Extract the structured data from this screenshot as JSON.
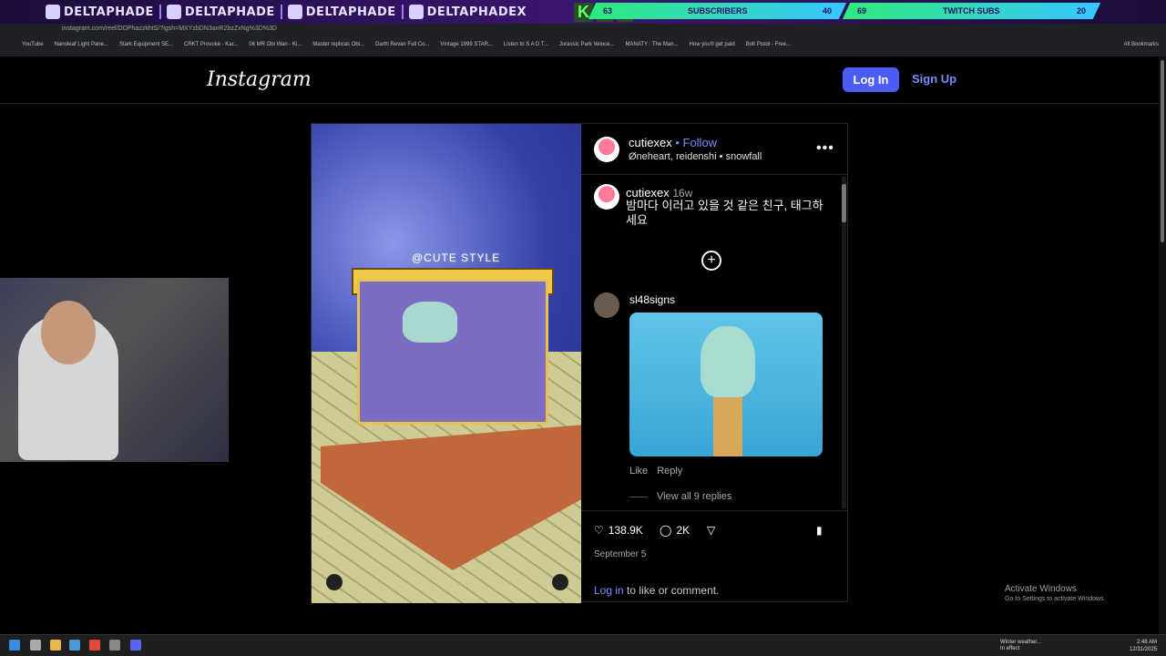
{
  "overlay": {
    "social_tags": [
      "DELTAPHADE",
      "DELTAPHADE",
      "DELTAPHADE",
      "DELTAPHADEX"
    ],
    "k_letters": [
      "K",
      "6",
      "3"
    ],
    "stats": [
      {
        "value": "63",
        "label": "SUBSCRIBERS",
        "count": "40"
      },
      {
        "value": "69",
        "label": "TWITCH SUBS",
        "count": "20"
      }
    ]
  },
  "browser": {
    "url": "instagram.com/reel/DOPhazzkhtS/?igsh=MXYzbDN3anR2bzZxNg%3D%3D",
    "bookmarks": [
      "YouTube",
      "Nanoleaf Light Pane...",
      "Stark Equipment SE...",
      "CRKT Provoke - Kar...",
      "06 MR Obi Wan - Ki...",
      "Master replicas Obi...",
      "Darth Revan Full Co...",
      "Vintage 1999 STAR...",
      "Listen to S A D T...",
      "Jurassic Park Veloce...",
      "MANATY : The Man...",
      "How you'll get paid",
      "Bolt Pistol - Free..."
    ],
    "all_bookmarks": "All Bookmarks"
  },
  "header": {
    "logo": "Instagram",
    "login": "Log In",
    "signup": "Sign Up"
  },
  "post": {
    "watermark": "@CUTE STYLE",
    "author": "cutiexex",
    "follow": "Follow",
    "audio": "Øneheart, reidenshi • snowfall",
    "more": "•••",
    "caption_author": "cutiexex",
    "caption_time": "16w",
    "caption": "밤마다 이러고 있을 것 같은 친구, 태그하세요",
    "comment_author": "sl48signs",
    "comment_like": "Like",
    "comment_reply": "Reply",
    "view_replies": "View all 9 replies",
    "likes": "138.9K",
    "comments_count": "2K",
    "date": "September 5",
    "login_link": "Log in",
    "login_text": " to like or comment."
  },
  "windows": {
    "activate_title": "Activate Windows",
    "activate_sub": "Go to Settings to activate Windows.",
    "weather": "Winter weather...",
    "weather_sub": "In effect",
    "time": "2:48 AM",
    "date": "12/31/2025"
  }
}
